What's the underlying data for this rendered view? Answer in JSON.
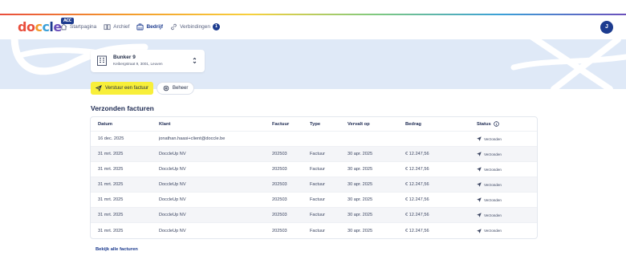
{
  "brand": {
    "logo_letters": [
      "do",
      "c",
      "c",
      "l",
      "e"
    ],
    "env_badge": "ACC",
    "colors": {
      "primary": "#1d3c8f",
      "highlight": "#f8ef3a",
      "banner": "#dfe9f7"
    }
  },
  "nav": {
    "items": [
      {
        "label": "Startpagina",
        "icon": "home-icon"
      },
      {
        "label": "Archief",
        "icon": "archive-icon"
      },
      {
        "label": "Bedrijf",
        "icon": "company-icon",
        "active": true
      },
      {
        "label": "Verbindingen",
        "icon": "link-icon",
        "badge": "1"
      }
    ]
  },
  "user": {
    "avatar_initial": "J"
  },
  "company": {
    "name": "Bunker 9",
    "address": "Keibergstraat 9, 3001, Leuven"
  },
  "actions": {
    "send_invoice": "Verstuur een factuur",
    "manage": "Beheer"
  },
  "sent_invoices": {
    "title": "Verzonden facturen",
    "columns": [
      "Datum",
      "Klant",
      "Factuur",
      "Type",
      "Vervalt op",
      "Bedrag",
      "Status"
    ],
    "rows": [
      {
        "date": "16 dec. 2025",
        "client": "jonathan.haasi+client@doccle.be",
        "invoice": "",
        "type": "",
        "due": "",
        "amount": "",
        "status": "Verzonden"
      },
      {
        "date": "31 mrt. 2025",
        "client": "DoccleUp NV",
        "invoice": "202503",
        "type": "Factuur",
        "due": "30 apr. 2025",
        "amount": "€ 12.247,56",
        "status": "Verzonden"
      },
      {
        "date": "31 mrt. 2025",
        "client": "DoccleUp NV",
        "invoice": "202503",
        "type": "Factuur",
        "due": "30 apr. 2025",
        "amount": "€ 12.247,56",
        "status": "Verzonden"
      },
      {
        "date": "31 mrt. 2025",
        "client": "DoccleUp NV",
        "invoice": "202503",
        "type": "Factuur",
        "due": "30 apr. 2025",
        "amount": "€ 12.247,56",
        "status": "Verzonden"
      },
      {
        "date": "31 mrt. 2025",
        "client": "DoccleUp NV",
        "invoice": "202503",
        "type": "Factuur",
        "due": "30 apr. 2025",
        "amount": "€ 12.247,56",
        "status": "Verzonden"
      },
      {
        "date": "31 mrt. 2025",
        "client": "DoccleUp NV",
        "invoice": "202503",
        "type": "Factuur",
        "due": "30 apr. 2025",
        "amount": "€ 12.247,56",
        "status": "Verzonden"
      },
      {
        "date": "31 mrt. 2025",
        "client": "DoccleUp NV",
        "invoice": "202503",
        "type": "Factuur",
        "due": "30 apr. 2025",
        "amount": "€ 12.247,56",
        "status": "Verzonden"
      }
    ],
    "view_all": "Bekijk alle facturen"
  }
}
